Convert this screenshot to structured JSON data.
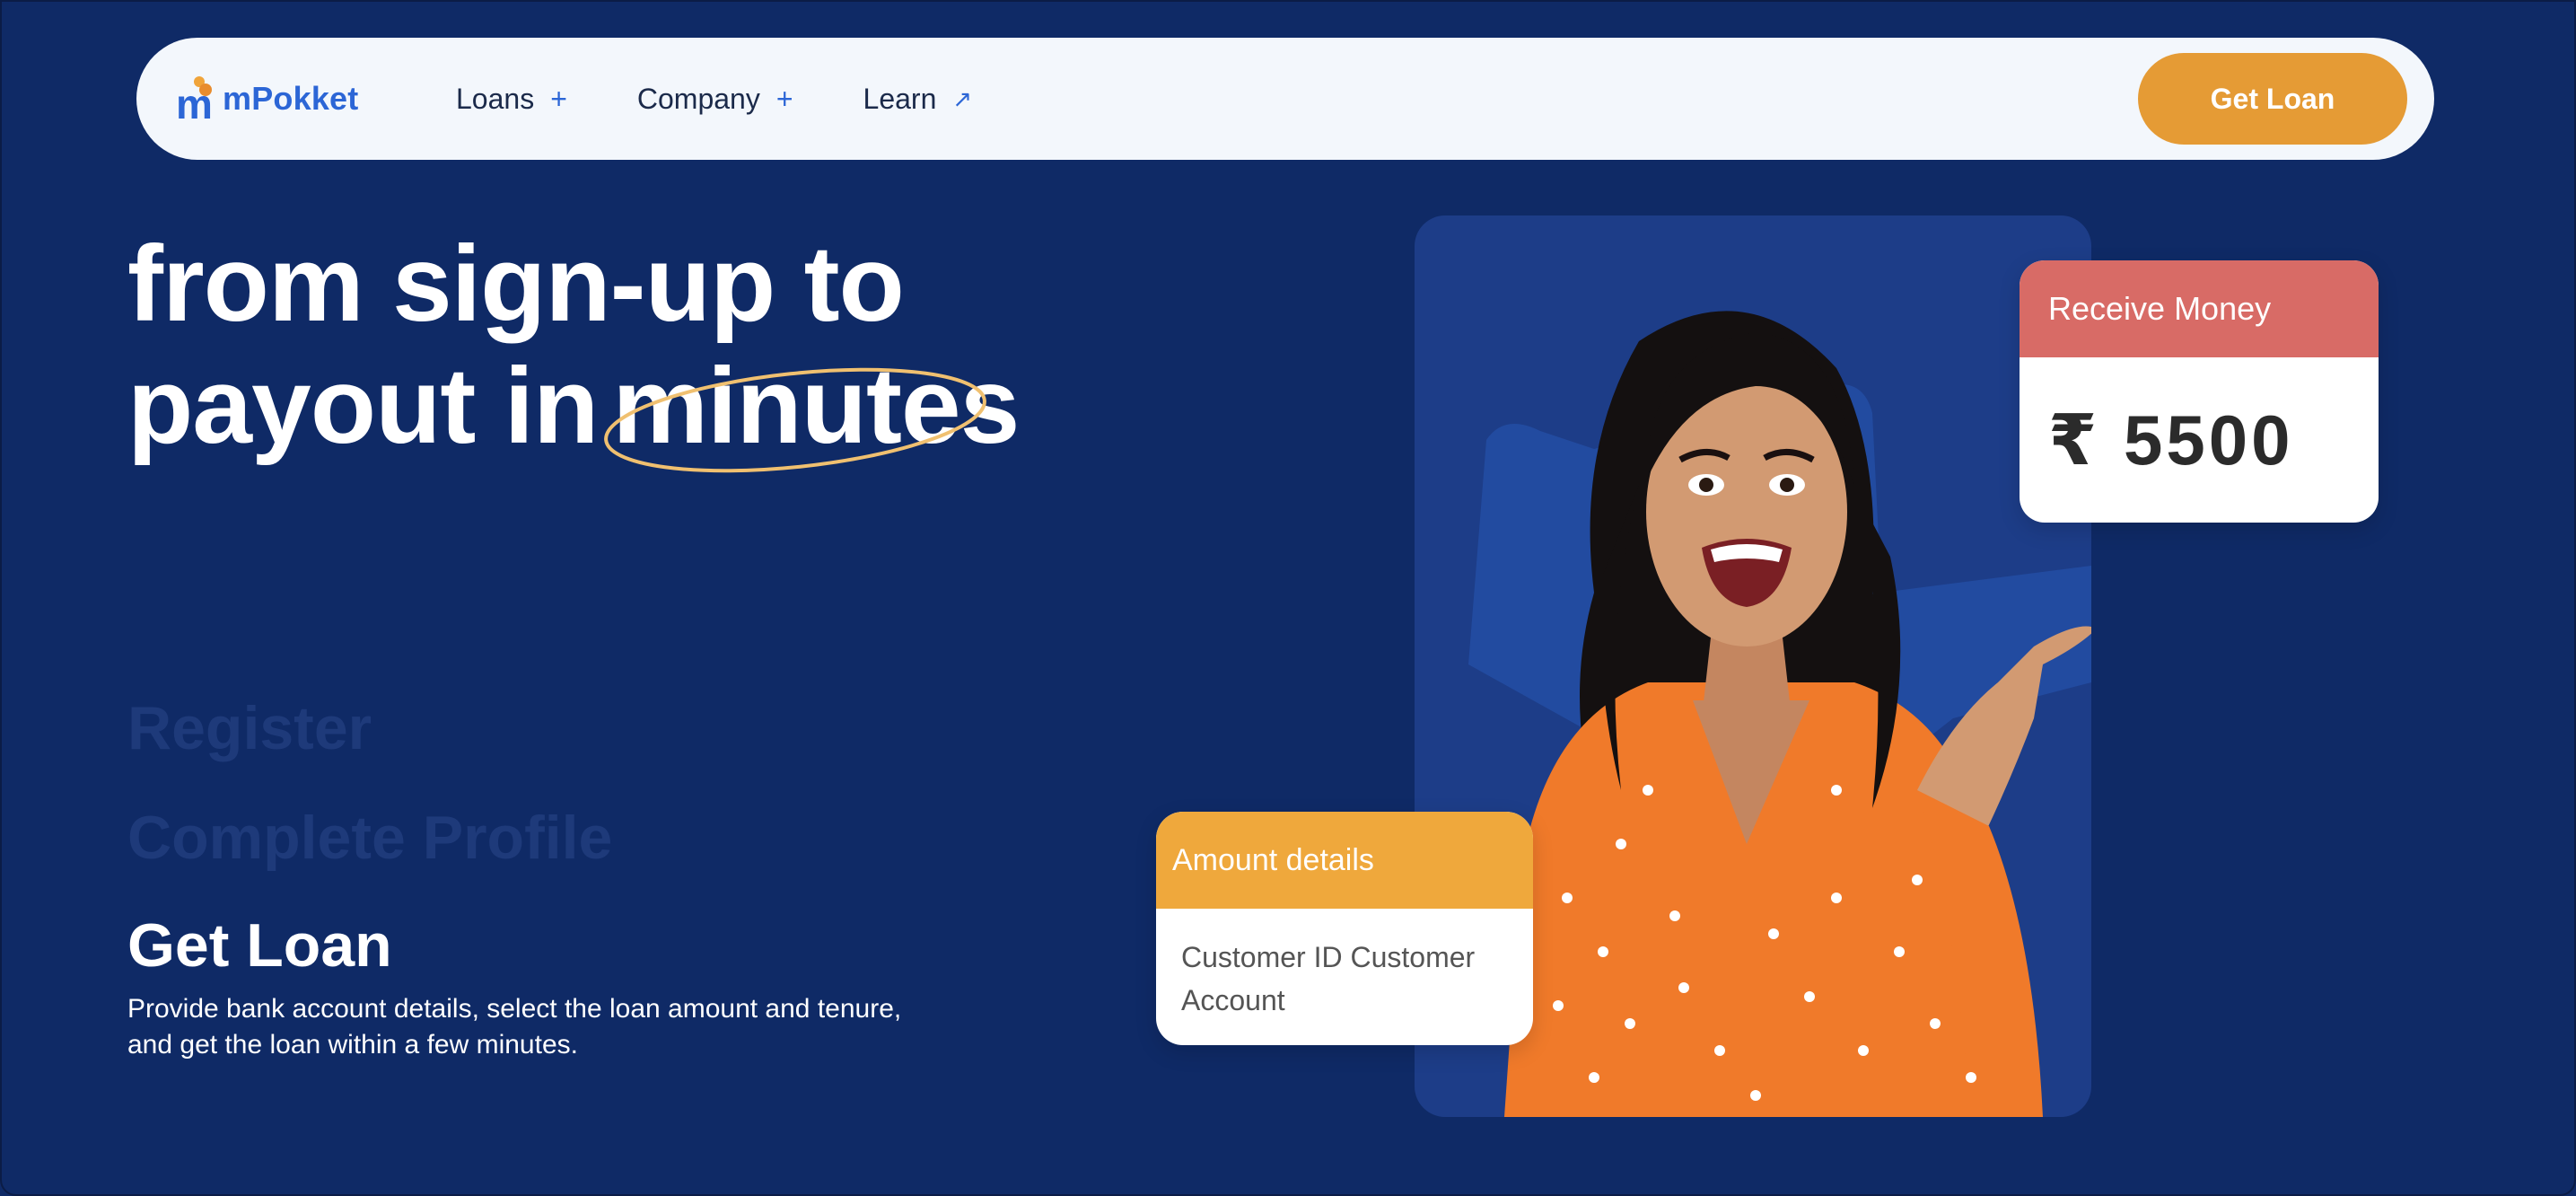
{
  "brand": {
    "name": "mPokket"
  },
  "nav": {
    "items": [
      {
        "label": "Loans",
        "icon": "plus-icon",
        "glyph": "+"
      },
      {
        "label": "Company",
        "icon": "plus-icon",
        "glyph": "+"
      },
      {
        "label": "Learn",
        "icon": "external-arrow-icon",
        "glyph": "↗"
      }
    ],
    "cta_label": "Get Loan"
  },
  "hero": {
    "title_line1": "from sign-up to",
    "title_line2_prefix": "payout in",
    "title_highlight": "minutes"
  },
  "steps": [
    {
      "label": "Register",
      "state": "inactive"
    },
    {
      "label": "Complete Profile",
      "state": "inactive"
    },
    {
      "label": "Get Loan",
      "state": "active",
      "description": "Provide bank account details, select the loan amount and tenure, and get the loan within a few minutes."
    }
  ],
  "cards": {
    "receive": {
      "title": "Receive Money",
      "amount": "₹ 5500"
    },
    "amount_details": {
      "title": "Amount details",
      "body": "Customer ID Customer Account"
    }
  },
  "colors": {
    "background": "#0f2a66",
    "accent": "#e59b35",
    "brand_blue": "#2c66d6",
    "receive_header": "#d86b66",
    "amount_header": "#efa83c"
  }
}
